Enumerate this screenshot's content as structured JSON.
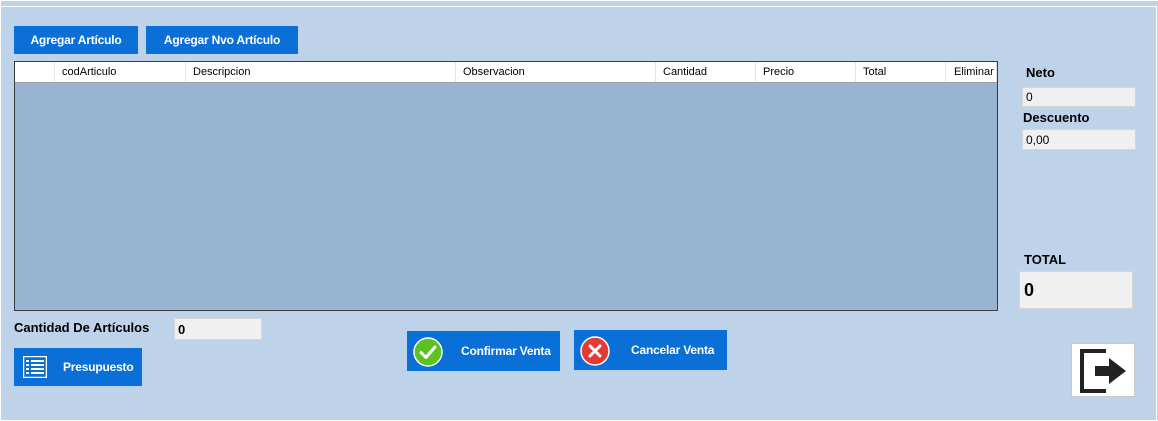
{
  "toolbar": {
    "add_article": "Agregar Artículo",
    "add_new_article": "Agregar Nvo Artículo"
  },
  "grid": {
    "columns": [
      "",
      "codArticulo",
      "Descripcion",
      "Observacion",
      "Cantidad",
      "Precio",
      "Total",
      "Eliminar"
    ]
  },
  "summary": {
    "neto_label": "Neto",
    "neto_value": "0",
    "descuento_label": "Descuento",
    "descuento_value": "0,00",
    "total_label": "TOTAL",
    "total_value": "0"
  },
  "footer": {
    "cantidad_label": "Cantidad De Artículos",
    "cantidad_value": "0",
    "presupuesto": "Presupuesto",
    "confirmar": "Confirmar Venta",
    "cancelar": "Cancelar Venta"
  },
  "icons": {
    "presupuesto": "list-icon",
    "confirmar": "check-icon",
    "cancelar": "close-icon",
    "exit": "exit-icon"
  },
  "colors": {
    "background": "#bed2ea",
    "button": "#0a6fd6",
    "grid_body": "#99b4d1",
    "confirm_green": "#5cc21f",
    "cancel_red": "#e53935"
  }
}
